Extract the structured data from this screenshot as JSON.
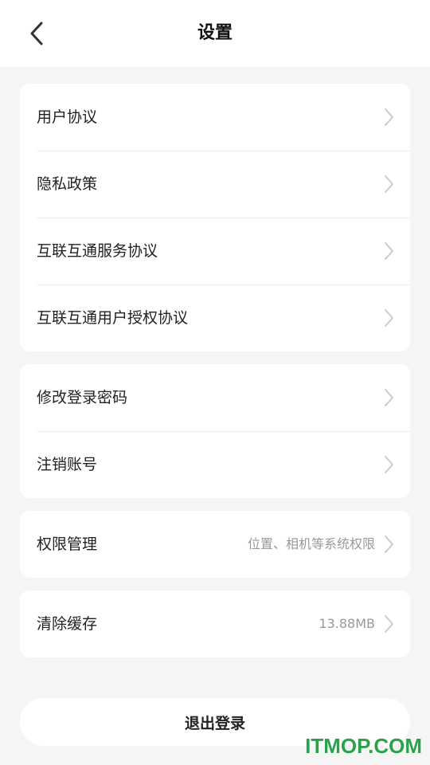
{
  "header": {
    "title": "设置",
    "back_icon": "chevron-left-icon"
  },
  "group1": {
    "items": [
      {
        "label": "用户协议"
      },
      {
        "label": "隐私政策"
      },
      {
        "label": "互联互通服务协议"
      },
      {
        "label": "互联互通用户授权协议"
      }
    ]
  },
  "group2": {
    "items": [
      {
        "label": "修改登录密码"
      },
      {
        "label": "注销账号"
      }
    ]
  },
  "group3": {
    "items": [
      {
        "label": "权限管理",
        "value": "位置、相机等系统权限"
      }
    ]
  },
  "group4": {
    "items": [
      {
        "label": "清除缓存",
        "value": "13.88MB"
      }
    ]
  },
  "logout": {
    "label": "退出登录"
  },
  "watermark": {
    "text": "ITMOP.COM"
  },
  "colors": {
    "background": "#f5f5f5",
    "card": "#ffffff",
    "text_primary": "#222222",
    "text_secondary": "#999999",
    "chevron": "#cccccc",
    "watermark": "#2aa24a"
  }
}
